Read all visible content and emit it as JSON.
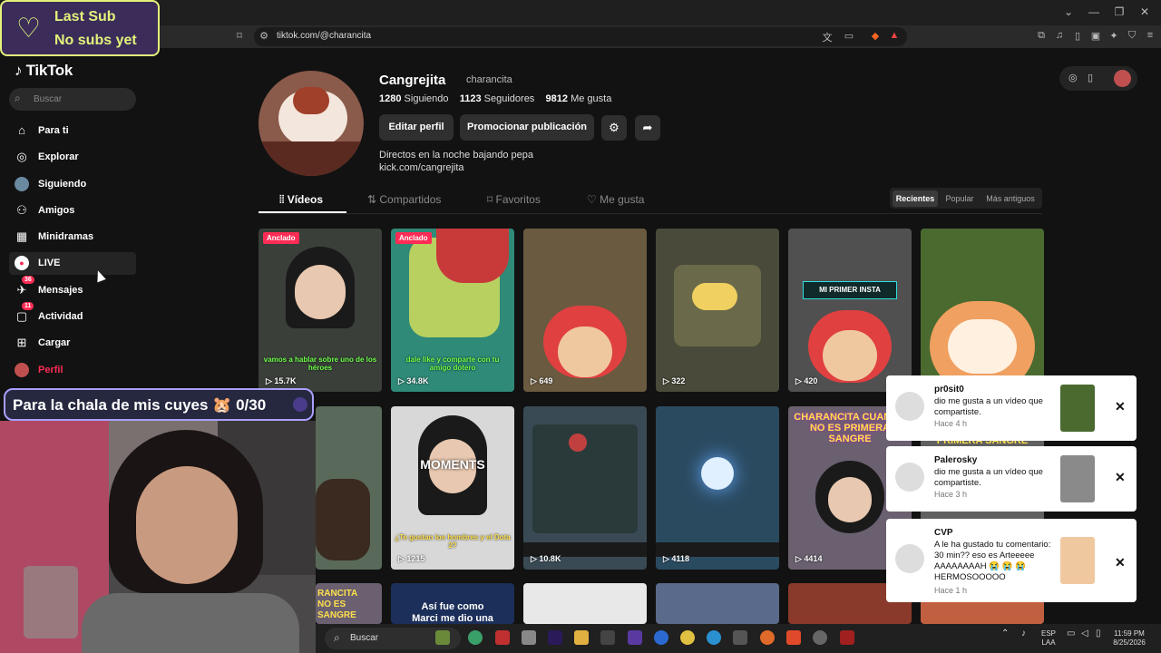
{
  "browser": {
    "url": "tiktok.com/@charancita"
  },
  "overlay": {
    "sub_line1": "Last Sub",
    "sub_line2": "No subs yet",
    "goal": "Para la chala de mis cuyes 🐹 0/30"
  },
  "sidebar": {
    "logo": "TikTok",
    "search_placeholder": "Buscar",
    "items": [
      {
        "label": "Para ti",
        "icon": "home-icon"
      },
      {
        "label": "Explorar",
        "icon": "compass-icon"
      },
      {
        "label": "Siguiendo",
        "icon": "following-avatar-icon"
      },
      {
        "label": "Amigos",
        "icon": "friends-icon"
      },
      {
        "label": "Minidramas",
        "icon": "film-icon"
      },
      {
        "label": "LIVE",
        "icon": "live-icon"
      },
      {
        "label": "Mensajes",
        "icon": "message-icon",
        "badge": "36"
      },
      {
        "label": "Actividad",
        "icon": "activity-icon",
        "badge": "11"
      },
      {
        "label": "Cargar",
        "icon": "upload-icon"
      },
      {
        "label": "Perfil",
        "icon": "profile-avatar-icon",
        "color": "#fe2c55"
      }
    ]
  },
  "profile": {
    "display_name": "Cangrejita",
    "username": "charancita",
    "following_count": "1280",
    "following_label": "Siguiendo",
    "followers_count": "1123",
    "followers_label": "Seguidores",
    "likes_count": "9812",
    "likes_label": "Me gusta",
    "edit_button": "Editar perfil",
    "promote_button": "Promocionar publicación",
    "bio_line1": "Directos en la noche bajando pepa",
    "bio_line2": "kick.com/cangrejita"
  },
  "tabs": [
    "Vídeos",
    "Compartidos",
    "Favoritos",
    "Me gusta"
  ],
  "sort": [
    "Recientes",
    "Popular",
    "Más antiguos"
  ],
  "videos": [
    {
      "views": "15.7K",
      "pinned": "Anclado",
      "caption": "vamos a hablar sobre uno de los héroes",
      "bg": "#3a3f3a"
    },
    {
      "views": "34.8K",
      "pinned": "Anclado",
      "caption": "dale like y comparte con tu amigo dotero",
      "bg": "#2f8a78"
    },
    {
      "views": "649",
      "caption": "",
      "bg": "#6a5a40"
    },
    {
      "views": "322",
      "caption": "",
      "bg": "#4a4a3a"
    },
    {
      "views": "420",
      "caption": "MI PRIMER INSTA",
      "bg": "#505050"
    },
    {
      "views": "",
      "caption": "",
      "bg": "#4a6a30"
    },
    {
      "views": "",
      "caption": "",
      "bg": "#5a6a5a"
    },
    {
      "views": "1215",
      "caption": "¿Te gustan los hombres y el Dota 2?",
      "title": "MOMENTS",
      "bg": "#d8d8d8"
    },
    {
      "views": "10.8K",
      "caption": "",
      "bg": "#3a4a55"
    },
    {
      "views": "4118",
      "caption": "",
      "bg": "#2a4a60"
    },
    {
      "views": "4414",
      "caption": "CHARANCITA CUANDO NO ES PRIMERA SANGRE",
      "bg": "#6a6070"
    },
    {
      "views": "",
      "caption": "",
      "bg": "#606060"
    }
  ],
  "notifications": [
    {
      "user": "pr0sit0",
      "msg": "dio me gusta a un vídeo que compartiste.",
      "time": "Hace 4 h"
    },
    {
      "user": "Palerosky",
      "msg": "dio me gusta a un vídeo que compartiste.",
      "time": "Hace 3 h"
    },
    {
      "user": "CVP",
      "msg": "A le ha gustado tu comentario: 30 min?? eso es Arteeeee AAAAAAAAH 😭 😭 😭 HERMOSOOOOO",
      "time": "Hace 1 h"
    }
  ],
  "taskbar": {
    "search": "Buscar",
    "lang_line1": "ESP",
    "lang_line2": "LAA",
    "time": "11:59 PM",
    "date": "8/25/2026"
  },
  "colors": {
    "accent": "#fe2c55",
    "overlay_border": "#e5f27a",
    "overlay_bg": "#3b2c5a"
  }
}
